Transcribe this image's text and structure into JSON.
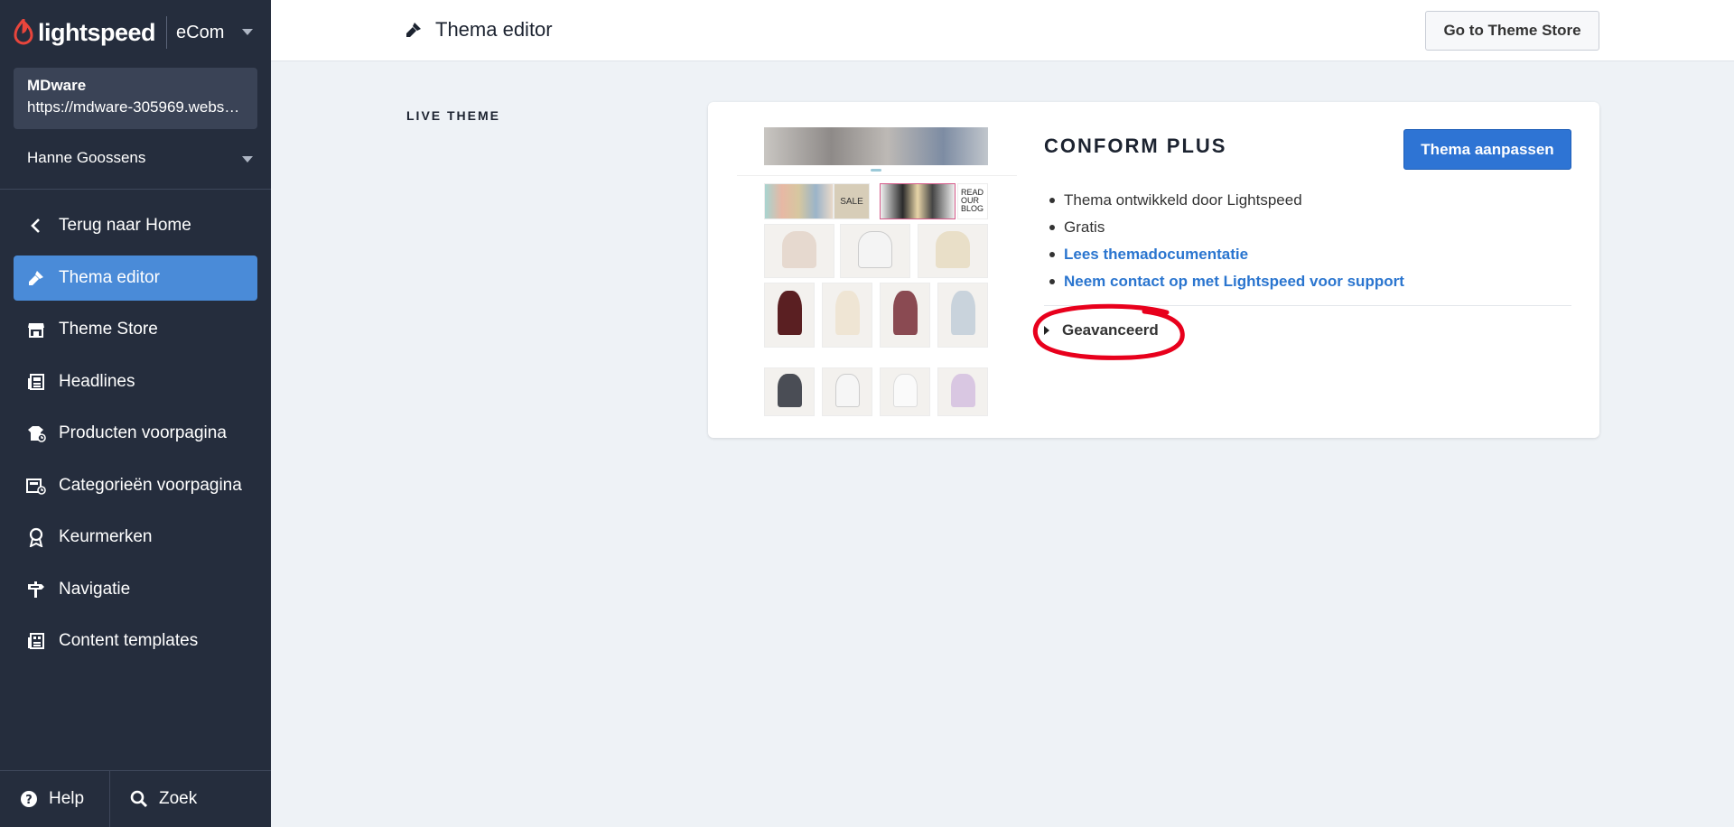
{
  "brand": {
    "name": "lightspeed",
    "product": "eCom",
    "accent": "#e8453c"
  },
  "shop": {
    "name": "MDware",
    "url": "https://mdware-305969.webshopapp.com"
  },
  "user": {
    "name": "Hanne Goossens"
  },
  "nav": [
    {
      "label": "Terug naar Home",
      "icon": "chevron-left-icon",
      "active": false
    },
    {
      "label": "Thema editor",
      "icon": "brush-icon",
      "active": true
    },
    {
      "label": "Theme Store",
      "icon": "store-icon",
      "active": false
    },
    {
      "label": "Headlines",
      "icon": "headlines-icon",
      "active": false
    },
    {
      "label": "Producten voorpagina",
      "icon": "products-icon",
      "active": false
    },
    {
      "label": "Categorieën voorpagina",
      "icon": "categories-icon",
      "active": false
    },
    {
      "label": "Keurmerken",
      "icon": "badge-icon",
      "active": false
    },
    {
      "label": "Navigatie",
      "icon": "navigation-icon",
      "active": false
    },
    {
      "label": "Content templates",
      "icon": "templates-icon",
      "active": false
    }
  ],
  "footer": {
    "help": "Help",
    "search": "Zoek"
  },
  "header": {
    "title": "Thema editor",
    "store_button": "Go to Theme Store"
  },
  "section": {
    "label": "LIVE THEME"
  },
  "theme": {
    "name": "CONFORM PLUS",
    "edit_button": "Thema aanpassen",
    "preview_sale": "SALE",
    "preview_blog": "READ OUR BLOG",
    "info": [
      {
        "text": "Thema ontwikkeld door Lightspeed",
        "link": false
      },
      {
        "text": "Gratis",
        "link": false
      },
      {
        "text": "Lees themadocumentatie",
        "link": true
      },
      {
        "text": "Neem contact op met Lightspeed voor support",
        "link": true
      }
    ],
    "advanced": "Geavanceerd"
  },
  "colors": {
    "sidebar": "#252d3d",
    "active": "#4a8bd8",
    "primary": "#2e74d4",
    "link": "#2a75cf",
    "annotation": "#e8001c"
  }
}
